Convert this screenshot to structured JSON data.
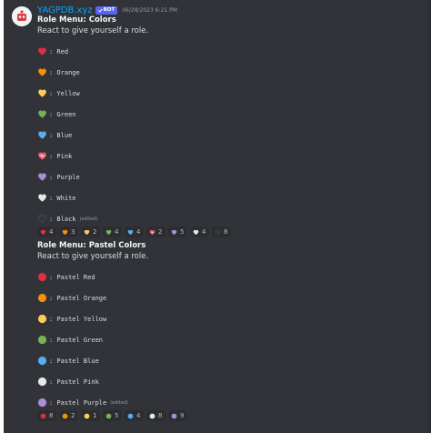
{
  "message": {
    "username": "YAGPDB.xyz",
    "bot_tag": "BOT",
    "timestamp": "06/28/2023 6:21 PM"
  },
  "colors_menu": {
    "title": "Role Menu: Colors",
    "subtitle": "React to give yourself a role.",
    "roles": [
      {
        "label": ": Red",
        "icon": "red-heart-icon",
        "color": "#dd2e44"
      },
      {
        "label": ": Orange",
        "icon": "orange-heart-icon",
        "color": "#f4900c"
      },
      {
        "label": ": Yellow",
        "icon": "yellow-heart-icon",
        "color": "#fdcb58"
      },
      {
        "label": ": Green",
        "icon": "green-heart-icon",
        "color": "#78b159"
      },
      {
        "label": ": Blue",
        "icon": "blue-heart-icon",
        "color": "#5dadec"
      },
      {
        "label": ": Pink",
        "icon": "heartbeat-icon",
        "color": "#ea596e"
      },
      {
        "label": ": Purple",
        "icon": "purple-heart-icon",
        "color": "#aa8ed6"
      },
      {
        "label": ": White",
        "icon": "white-heart-icon",
        "color": "#e6e7e8"
      },
      {
        "label": ": Black",
        "icon": "black-heart-icon",
        "color": "#31373d"
      }
    ],
    "edited": "(edited)",
    "reactions": [
      {
        "icon": "red-heart-icon",
        "color": "#dd2e44",
        "count": "4"
      },
      {
        "icon": "orange-heart-icon",
        "color": "#f4900c",
        "count": "3"
      },
      {
        "icon": "yellow-heart-icon",
        "color": "#fdcb58",
        "count": "2"
      },
      {
        "icon": "green-heart-icon",
        "color": "#78b159",
        "count": "4"
      },
      {
        "icon": "blue-heart-icon",
        "color": "#5dadec",
        "count": "4"
      },
      {
        "icon": "heartbeat-icon",
        "color": "#ea596e",
        "count": "2"
      },
      {
        "icon": "purple-heart-icon",
        "color": "#aa8ed6",
        "count": "5"
      },
      {
        "icon": "white-heart-icon",
        "color": "#e6e7e8",
        "count": "4"
      },
      {
        "icon": "black-heart-icon",
        "color": "#31373d",
        "count": "8"
      }
    ]
  },
  "pastel_menu": {
    "title": "Role Menu: Pastel Colors",
    "subtitle": "React to give yourself a role.",
    "roles": [
      {
        "label": ": Pastel Red",
        "icon": "red-circle-icon",
        "color": "#dd2e44"
      },
      {
        "label": ": Pastel Orange",
        "icon": "orange-circle-icon",
        "color": "#f4900c"
      },
      {
        "label": ": Pastel Yellow",
        "icon": "yellow-circle-icon",
        "color": "#fdcb58"
      },
      {
        "label": ": Pastel Green",
        "icon": "green-circle-icon",
        "color": "#78b159"
      },
      {
        "label": ": Pastel Blue",
        "icon": "blue-circle-icon",
        "color": "#55acee"
      },
      {
        "label": ": Pastel Pink",
        "icon": "white-circle-icon",
        "color": "#e6e7e8"
      },
      {
        "label": ": Pastel Purple",
        "icon": "purple-circle-icon",
        "color": "#aa8ed6"
      }
    ],
    "edited": "(edited)",
    "reactions": [
      {
        "icon": "red-circle-icon",
        "color": "#dd2e44",
        "count": "8"
      },
      {
        "icon": "orange-circle-icon",
        "color": "#f4900c",
        "count": "2"
      },
      {
        "icon": "yellow-circle-icon",
        "color": "#fdcb58",
        "count": "1"
      },
      {
        "icon": "green-circle-icon",
        "color": "#78b159",
        "count": "5"
      },
      {
        "icon": "blue-circle-icon",
        "color": "#55acee",
        "count": "4"
      },
      {
        "icon": "white-circle-icon",
        "color": "#e6e7e8",
        "count": "8"
      },
      {
        "icon": "purple-circle-icon",
        "color": "#aa8ed6",
        "count": "9"
      }
    ]
  }
}
